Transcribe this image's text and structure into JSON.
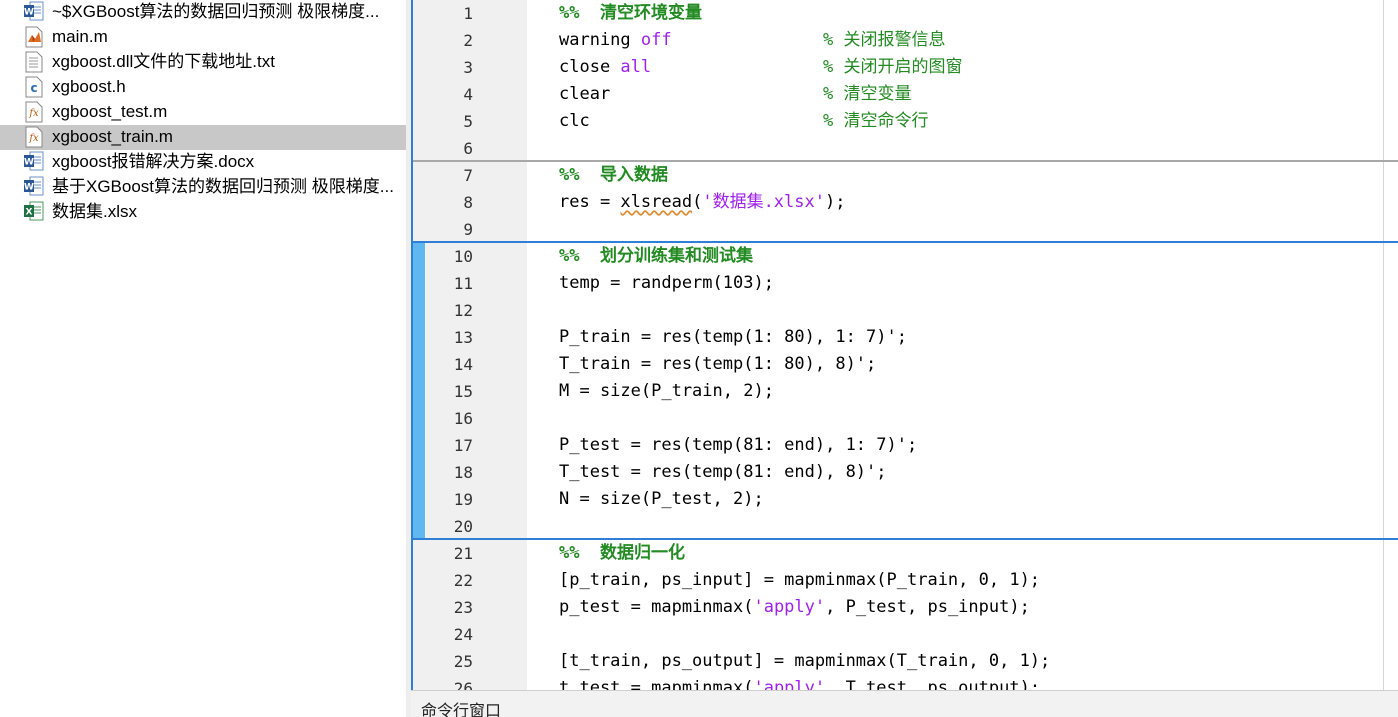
{
  "files": [
    {
      "name": "~$XGBoost算法的数据回归预测 极限梯度...",
      "type": "docx",
      "selected": false
    },
    {
      "name": "main.m",
      "type": "m",
      "selected": false
    },
    {
      "name": "xgboost.dll文件的下载地址.txt",
      "type": "txt",
      "selected": false
    },
    {
      "name": "xgboost.h",
      "type": "h",
      "selected": false
    },
    {
      "name": "xgboost_test.m",
      "type": "fx",
      "selected": false
    },
    {
      "name": "xgboost_train.m",
      "type": "fx",
      "selected": true
    },
    {
      "name": "xgboost报错解决方案.docx",
      "type": "docx",
      "selected": false
    },
    {
      "name": "基于XGBoost算法的数据回归预测 极限梯度...",
      "type": "docx",
      "selected": false
    },
    {
      "name": "数据集.xlsx",
      "type": "xlsx",
      "selected": false
    }
  ],
  "editor": {
    "lines": [
      {
        "num": "1",
        "parts": [
          {
            "t": "%%  清空环境变量",
            "c": "cellhead"
          }
        ]
      },
      {
        "num": "2",
        "parts": [
          {
            "t": "warning ",
            "c": ""
          },
          {
            "t": "off",
            "c": "kw"
          }
        ],
        "comment": "% 关闭报警信息"
      },
      {
        "num": "3",
        "parts": [
          {
            "t": "close ",
            "c": ""
          },
          {
            "t": "all",
            "c": "kw"
          }
        ],
        "comment": "% 关闭开启的图窗"
      },
      {
        "num": "4",
        "parts": [
          {
            "t": "clear",
            "c": ""
          }
        ],
        "comment": "% 清空变量"
      },
      {
        "num": "5",
        "parts": [
          {
            "t": "clc",
            "c": ""
          }
        ],
        "comment": "% 清空命令行"
      },
      {
        "num": "6",
        "parts": []
      },
      {
        "num": "7",
        "parts": [
          {
            "t": "%%  导入数据",
            "c": "cellhead"
          }
        ]
      },
      {
        "num": "8",
        "parts": [
          {
            "t": "res = ",
            "c": ""
          },
          {
            "t": "xlsread",
            "c": "squiggle"
          },
          {
            "t": "(",
            "c": ""
          },
          {
            "t": "'数据集.xlsx'",
            "c": "str"
          },
          {
            "t": ");",
            "c": ""
          }
        ]
      },
      {
        "num": "9",
        "parts": []
      },
      {
        "num": "10",
        "parts": [
          {
            "t": "%%  划分训练集和测试集",
            "c": "cellhead"
          }
        ]
      },
      {
        "num": "11",
        "parts": [
          {
            "t": "temp = randperm(103);",
            "c": ""
          }
        ]
      },
      {
        "num": "12",
        "parts": []
      },
      {
        "num": "13",
        "parts": [
          {
            "t": "P_train = res(temp(1: 80), 1: 7)';",
            "c": ""
          }
        ]
      },
      {
        "num": "14",
        "parts": [
          {
            "t": "T_train = res(temp(1: 80), 8)';",
            "c": ""
          }
        ]
      },
      {
        "num": "15",
        "parts": [
          {
            "t": "M = size(P_train, 2);",
            "c": ""
          }
        ]
      },
      {
        "num": "16",
        "parts": []
      },
      {
        "num": "17",
        "parts": [
          {
            "t": "P_test = res(temp(81: end), 1: 7)';",
            "c": ""
          }
        ]
      },
      {
        "num": "18",
        "parts": [
          {
            "t": "T_test = res(temp(81: end), 8)';",
            "c": ""
          }
        ]
      },
      {
        "num": "19",
        "parts": [
          {
            "t": "N = size(P_test, 2);",
            "c": ""
          }
        ]
      },
      {
        "num": "20",
        "parts": []
      },
      {
        "num": "21",
        "parts": [
          {
            "t": "%%  数据归一化",
            "c": "cellhead"
          }
        ]
      },
      {
        "num": "22",
        "parts": [
          {
            "t": "[p_train, ps_input] = mapminmax(P_train, 0, 1);",
            "c": ""
          }
        ]
      },
      {
        "num": "23",
        "parts": [
          {
            "t": "p_test = mapminmax(",
            "c": ""
          },
          {
            "t": "'apply'",
            "c": "str"
          },
          {
            "t": ", P_test, ps_input);",
            "c": ""
          }
        ]
      },
      {
        "num": "24",
        "parts": []
      },
      {
        "num": "25",
        "parts": [
          {
            "t": "[t_train, ps_output] = mapminmax(T_train, 0, 1);",
            "c": ""
          }
        ]
      },
      {
        "num": "26",
        "parts": [
          {
            "t": "t_test = mapminmax(",
            "c": ""
          },
          {
            "t": "'apply'",
            "c": "str"
          },
          {
            "t": ", T_test, ps_output);",
            "c": ""
          }
        ]
      }
    ]
  },
  "command_panel": {
    "title": "命令行窗口"
  }
}
